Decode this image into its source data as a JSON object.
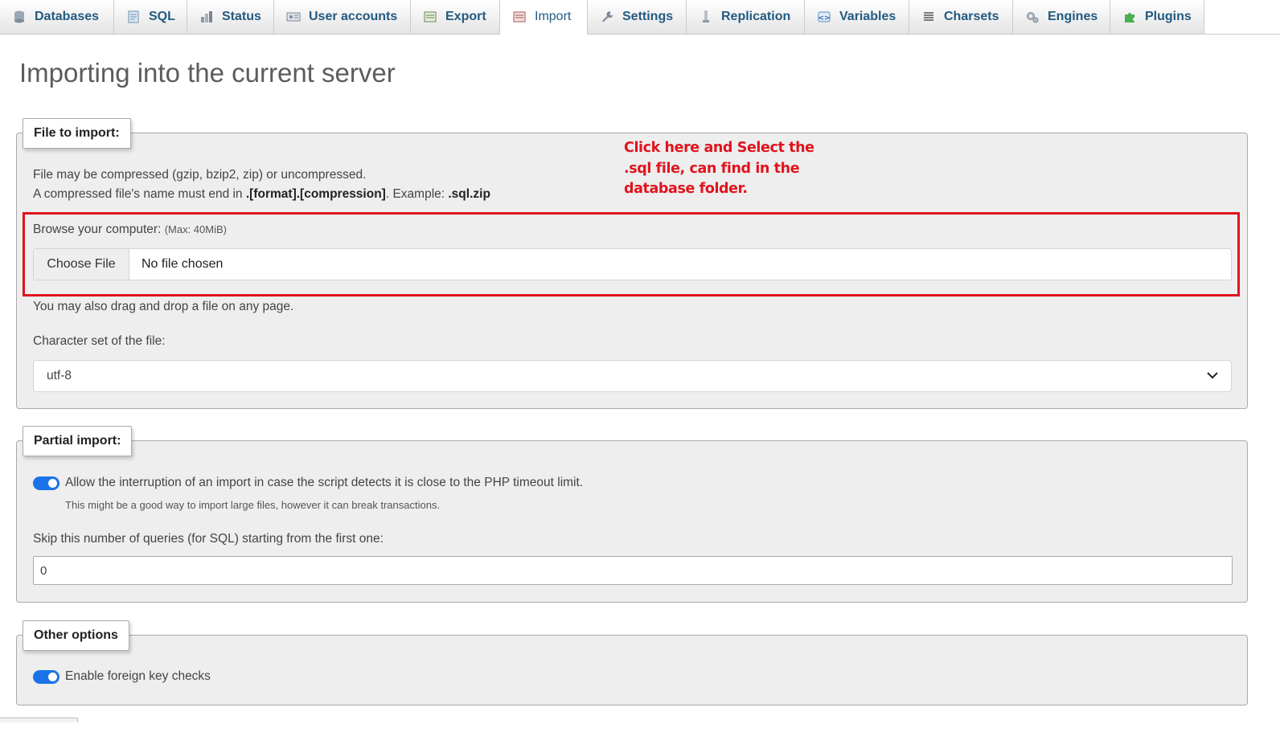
{
  "tabs": [
    {
      "label": "Databases",
      "icon": "databases-icon",
      "active": false
    },
    {
      "label": "SQL",
      "icon": "sql-icon",
      "active": false
    },
    {
      "label": "Status",
      "icon": "status-icon",
      "active": false
    },
    {
      "label": "User accounts",
      "icon": "user-accounts-icon",
      "active": false
    },
    {
      "label": "Export",
      "icon": "export-icon",
      "active": false
    },
    {
      "label": "Import",
      "icon": "import-icon",
      "active": true
    },
    {
      "label": "Settings",
      "icon": "wrench-icon",
      "active": false
    },
    {
      "label": "Replication",
      "icon": "replication-icon",
      "active": false
    },
    {
      "label": "Variables",
      "icon": "variables-icon",
      "active": false
    },
    {
      "label": "Charsets",
      "icon": "charsets-icon",
      "active": false
    },
    {
      "label": "Engines",
      "icon": "engines-icon",
      "active": false
    },
    {
      "label": "Plugins",
      "icon": "puzzle-icon",
      "active": false
    }
  ],
  "page": {
    "title": "Importing into the current server"
  },
  "file_import": {
    "legend": "File to import:",
    "compress_line1": "File may be compressed (gzip, bzip2, zip) or uncompressed.",
    "compress_line2_prefix": "A compressed file's name must end in ",
    "compress_line2_format": ".[format].[compression]",
    "compress_line2_mid": ". Example: ",
    "compress_line2_example": ".sql.zip",
    "browse_label": "Browse your computer:",
    "max_size": "(Max: 40MiB)",
    "choose_button": "Choose File",
    "file_status": "No file chosen",
    "drag_drop_note": "You may also drag and drop a file on any page.",
    "charset_label": "Character set of the file:",
    "charset_value": "utf-8"
  },
  "partial_import": {
    "legend": "Partial import:",
    "allow_interrupt_label": "Allow the interruption of an import in case the script detects it is close to the PHP timeout limit.",
    "allow_interrupt_hint": "This might be a good way to import large files, however it can break transactions.",
    "allow_interrupt_on": true,
    "skip_label": "Skip this number of queries (for SQL) starting from the first one:",
    "skip_value": "0"
  },
  "other_options": {
    "legend": "Other options",
    "foreign_key_label": "Enable foreign key checks",
    "foreign_key_on": true
  },
  "annotation": {
    "line1": "Click here and Select the",
    "line2": ".sql file, can find in the",
    "line3": "database folder.",
    "color": "#e0141e"
  },
  "colors": {
    "tab_text": "#235a81",
    "toggle_on": "#1a73e8",
    "panel_bg": "#eeeeee"
  }
}
